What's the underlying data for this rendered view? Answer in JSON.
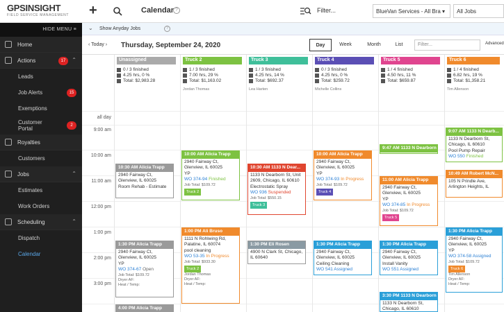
{
  "brand": {
    "name": "GPSINSIGHT",
    "tagline": "FIELD SERVICE MANAGEMENT"
  },
  "sidebar": {
    "hide_label": "HIDE MENU",
    "items": [
      {
        "label": "Home",
        "type": "top"
      },
      {
        "label": "Actions",
        "type": "top",
        "badge": "17"
      },
      {
        "label": "Leads",
        "type": "sub"
      },
      {
        "label": "Job Alerts",
        "type": "sub",
        "badge": "15"
      },
      {
        "label": "Exemptions",
        "type": "sub"
      },
      {
        "label": "Customer Portal",
        "type": "sub",
        "badge": "2"
      },
      {
        "label": "Royalties",
        "type": "top"
      },
      {
        "label": "Customers",
        "type": "sub"
      },
      {
        "label": "Jobs",
        "type": "top"
      },
      {
        "label": "Estimates",
        "type": "sub"
      },
      {
        "label": "Work Orders",
        "type": "sub"
      },
      {
        "label": "Scheduling",
        "type": "top"
      },
      {
        "label": "Dispatch",
        "type": "sub"
      },
      {
        "label": "Calendar",
        "type": "sub",
        "active": true
      }
    ]
  },
  "topbar": {
    "title": "Calendar",
    "filter_label": "Filter...",
    "select1": "BlueVan Services - All Bra",
    "select2": "All Jobs"
  },
  "bluebar": {
    "label": "Show Anyday Jobs"
  },
  "navbar": {
    "today": "Today",
    "date": "Thursday, September 24, 2020",
    "views": [
      "Day",
      "Week",
      "Month",
      "List"
    ],
    "filter_placeholder": "Filter...",
    "advanced": "Advanced"
  },
  "times": {
    "allday": "all day",
    "t9": "9:00 am",
    "t10": "10:00 am",
    "t11": "11:00 am",
    "t12": "12:00 pm",
    "t1": "1:00 pm",
    "t2": "2:00 pm",
    "t3": "3:00 pm"
  },
  "columns": [
    {
      "name": "Unassigned",
      "color": "#aaaaaa",
      "finished": "0 / 3 finished",
      "hrs": "4.25 hrs, 0 %",
      "total": "Total: $2,983.28",
      "driver": ""
    },
    {
      "name": "Truck 2",
      "color": "#7dc242",
      "finished": "1 / 3 finished",
      "hrs": "7.00 hrs, 29 %",
      "total": "Total: $1,163.02",
      "driver": "Jordan Thomas"
    },
    {
      "name": "Truck 3",
      "color": "#3fbf9a",
      "finished": "1 / 3 finished",
      "hrs": "4.25 hrs, 14 %",
      "total": "Total: $692.37",
      "driver": "Lea Harten"
    },
    {
      "name": "Truck 4",
      "color": "#5b4fb5",
      "finished": "0 / 3 finished",
      "hrs": "4.25 hrs, 0 %",
      "total": "Total: $259.72",
      "driver": "Michelle Collins"
    },
    {
      "name": "Truck 5",
      "color": "#e0458f",
      "finished": "1 / 4 finished",
      "hrs": "4.50 hrs, 11 %",
      "total": "Total: $659.87",
      "driver": ""
    },
    {
      "name": "Truck 6",
      "color": "#f08a2c",
      "finished": "1 / 4 finished",
      "hrs": "6.82 hrs, 19 %",
      "total": "Total: $1,358.21",
      "driver": "Tim Allenson"
    }
  ],
  "events": {
    "u1": {
      "time": "10:30 AM",
      "name": "Alicia Trapp",
      "addr": "2940 Fairway Ct, Glenview, IL 60025",
      "desc": "Room Rehab - Estimate"
    },
    "u2": {
      "time": "1:30 PM",
      "name": "Alicia Trapp",
      "addr": "2940 Fairway Ct, Glenview, IL 60025",
      "yp": "YP",
      "wo": "WO 374-67",
      "status": "Open",
      "total": "Job Total: $109.72",
      "dryer": "Dryer AF:",
      "heat": "Heat / Temp:"
    },
    "u3": {
      "time": "4:00 PM",
      "name": "Alicia Trapp"
    },
    "t2a": {
      "time": "10:00 AM",
      "name": "Alicia Trapp",
      "addr": "2940 Fairway Ct, Glenview, IL 60025",
      "yp": "YP",
      "wo": "WO 374-94",
      "status": "Finished",
      "total": "Job Total: $109.72",
      "tag": "Truck 2"
    },
    "t2b": {
      "time": "1:00 PM",
      "name": "Ali Bruso",
      "addr": "1111 N Rohlwing Rd, Palatine, IL 60074",
      "desc": "pool cleaning",
      "wo": "WO 53-35",
      "status": "In Progress",
      "total": "Job Total: $933.30",
      "tag": "Truck 2",
      "driver": "Jordan Thomas",
      "dryer": "Dryer AF:",
      "heat": "Heat / Temp:"
    },
    "t3a": {
      "time": "10:30 AM",
      "name": "1133 N Dear...",
      "addr": "1133 N Dearborn St, Unit 2609, Chicago, IL 60610",
      "desc": "Electrostatic Spray",
      "wo": "WO 936",
      "status": "Suspended",
      "total": "Job Total: $550.15",
      "tag": "Truck 3"
    },
    "t3b": {
      "time": "1:30 PM",
      "name": "Eli Rosen",
      "addr": "4900 N Clark St, Chicago, IL 60640"
    },
    "t4a": {
      "time": "10:00 AM",
      "name": "Alicia Trapp",
      "addr": "2940 Fairway Ct, Glenview, IL 60025",
      "yp": "YP",
      "wo": "WO 374-93",
      "status": "In Progress",
      "total": "Job Total: $109.72",
      "tag": "Truck 4"
    },
    "t4b": {
      "time": "1:30 PM",
      "name": "Alicia Trapp",
      "addr": "2940 Fairway Ct, Glenview, IL 60025",
      "desc": "Ceiling Cleaning",
      "wo": "WO 541",
      "status": "Assigned"
    },
    "t5a": {
      "time": "9:47 AM",
      "name": "1133 N Dearborn"
    },
    "t5b": {
      "time": "11:00 AM",
      "name": "Alicia Trapp",
      "addr": "2940 Fairway Ct, Glenview, IL 60025",
      "yp": "YP",
      "wo": "WO 374-85",
      "status": "In Progress",
      "total": "Job Total: $109.72",
      "tag": "Truck 5"
    },
    "t5c": {
      "time": "1:30 PM",
      "name": "Alicia Trapp",
      "addr": "2940 Fairway Ct, Glenview, IL 60025",
      "desc": "Install Vanity",
      "wo": "WO 551",
      "status": "Assigned"
    },
    "t5d": {
      "time": "3:30 PM",
      "name": "1133 N Dearborn",
      "addr": "1133 N Dearborn St, Chicago, IL 60610"
    },
    "t6a": {
      "time": "9:07 AM",
      "name": "1133 N Dearb...",
      "addr": "1133 N Dearborn St, Chicago, IL 60610",
      "desc": "Pool Pump Repair",
      "wo": "WO 550",
      "status": "Finished"
    },
    "t6b": {
      "time": "10:49 AM",
      "name": "Robert McN...",
      "addr": "105 N Prindle Ave, Arlington Heights, IL"
    },
    "t6c": {
      "time": "1:30 PM",
      "name": "Alicia Trapp",
      "addr": "2940 Fairway Ct, Glenview, IL 60025",
      "yp": "YP",
      "wo": "WO 374-58",
      "status": "Assigned",
      "total": "Job Total: $109.72",
      "tag": "Truck 6",
      "driver": "Tim Allenson",
      "dryer": "Dryer AF:",
      "heat": "Heat / Temp:"
    }
  },
  "colors": {
    "finished": "#7dc242",
    "progress": "#f08a2c",
    "suspended": "#e0452f",
    "assigned": "#2a7fd4",
    "open": "#666666"
  }
}
